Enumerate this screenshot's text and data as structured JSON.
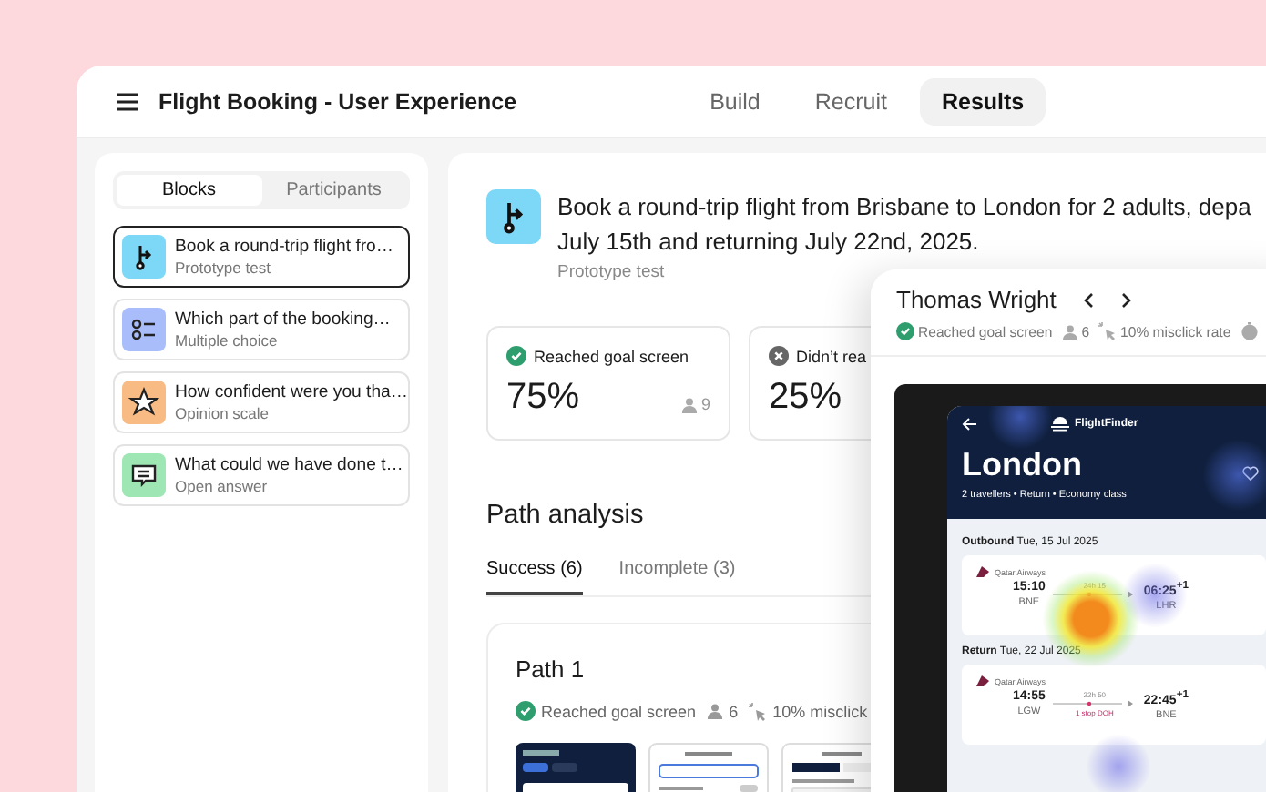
{
  "header": {
    "title": "Flight Booking - User Experience",
    "tabs": [
      {
        "label": "Build",
        "selected": false
      },
      {
        "label": "Recruit",
        "selected": false
      },
      {
        "label": "Results",
        "selected": true
      }
    ]
  },
  "sidebar": {
    "tabs": [
      {
        "label": "Blocks",
        "selected": true
      },
      {
        "label": "Participants",
        "selected": false
      }
    ],
    "blocks": [
      {
        "kind": "prototype",
        "color": "#7dd8f7",
        "title": "Book a round-trip flight fro…",
        "subtitle": "Prototype test",
        "selected": true
      },
      {
        "kind": "choice",
        "color": "#a9bdfb",
        "title": "Which part of the booking…",
        "subtitle": "Multiple choice",
        "selected": false
      },
      {
        "kind": "scale",
        "color": "#f8bb84",
        "title": "How confident were you tha…",
        "subtitle": "Opinion scale",
        "selected": false
      },
      {
        "kind": "answer",
        "color": "#9ee6b4",
        "title": "What could we have done t…",
        "subtitle": "Open answer",
        "selected": false
      }
    ]
  },
  "task": {
    "title_lines": [
      "Book a round-trip flight from Brisbane to London for 2 adults, depa",
      "July 15th and returning July 22nd, 2025."
    ],
    "kind_label": "Prototype test"
  },
  "stats": [
    {
      "kind": "success",
      "label": "Reached goal screen",
      "value": "75%",
      "count": "9"
    },
    {
      "kind": "fail",
      "label": "Didn’t rea",
      "value": "25%"
    }
  ],
  "path_analysis": {
    "title": "Path analysis",
    "tabs": [
      {
        "label": "Success (6)",
        "selected": true
      },
      {
        "label": "Incomplete (3)",
        "selected": false
      }
    ],
    "paths": [
      {
        "title": "Path 1",
        "status": "Reached goal screen",
        "count": "6",
        "misclick": "10% misclick"
      }
    ]
  },
  "participant": {
    "name": "Thomas Wright",
    "status": "Reached goal screen",
    "count": "6",
    "misclick": "10% misclick rate",
    "screen": {
      "app_name": "FlightFinder",
      "destination": "London",
      "details": "2 travellers • Return • Economy class",
      "legs": [
        {
          "label": "Outbound",
          "date": "Tue, 15 Jul 2025",
          "airline": "Qatar Airways",
          "depart_time": "15:10",
          "depart_airport": "BNE",
          "duration": "24h 15",
          "arrive_time": "06:25",
          "arrive_day": "+1",
          "arrive_airport": "LHR"
        },
        {
          "label": "Return",
          "date": "Tue, 22 Jul 2025",
          "airline": "Qatar Airways",
          "depart_time": "14:55",
          "depart_airport": "LGW",
          "duration": "22h 50",
          "stops": "1 stop DOH",
          "arrive_time": "22:45",
          "arrive_day": "+1",
          "arrive_airport": "BNE"
        }
      ]
    }
  }
}
